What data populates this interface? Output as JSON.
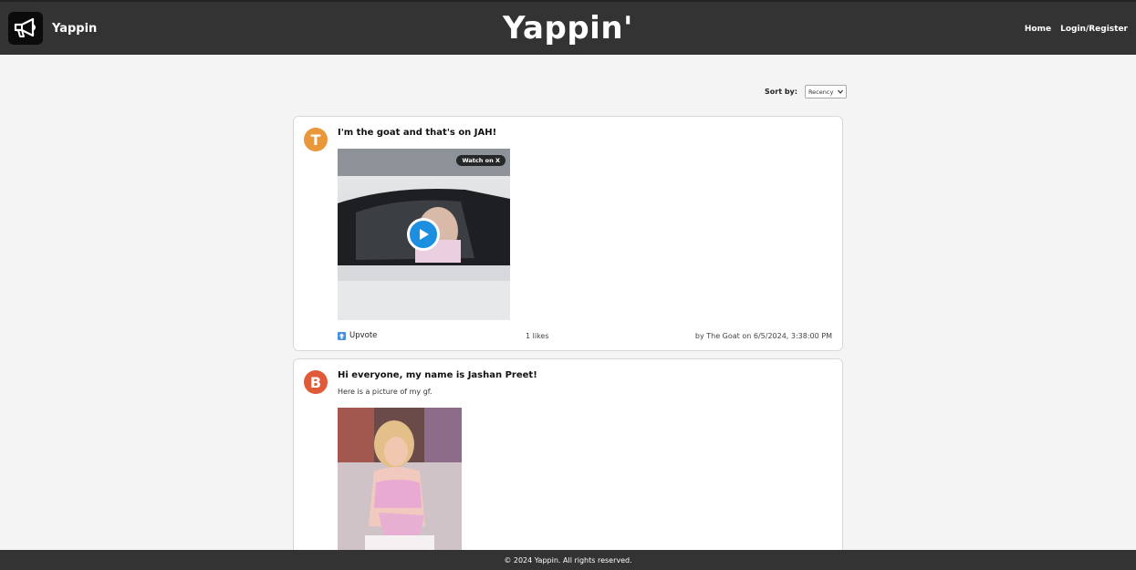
{
  "header": {
    "brand": "Yappin",
    "title": "Yappin'",
    "nav": [
      "Home",
      "Login/Register"
    ]
  },
  "sort": {
    "label": "Sort by:",
    "selected": "Recency"
  },
  "posts": [
    {
      "avatar_letter": "T",
      "avatar_color": "#e8973a",
      "title": "I'm the goat and that's on JAH!",
      "media_badge": "Watch on X",
      "upvote_label": "Upvote",
      "likes": "1 likes",
      "byline": "by The Goat on 6/5/2024, 3:38:00 PM"
    },
    {
      "avatar_letter": "B",
      "avatar_color": "#e05a3a",
      "title": "Hi everyone, my name is Jashan Preet!",
      "body": "Here is a picture of my gf."
    }
  ],
  "footer": {
    "text": "© 2024 Yappin. All rights reserved."
  }
}
